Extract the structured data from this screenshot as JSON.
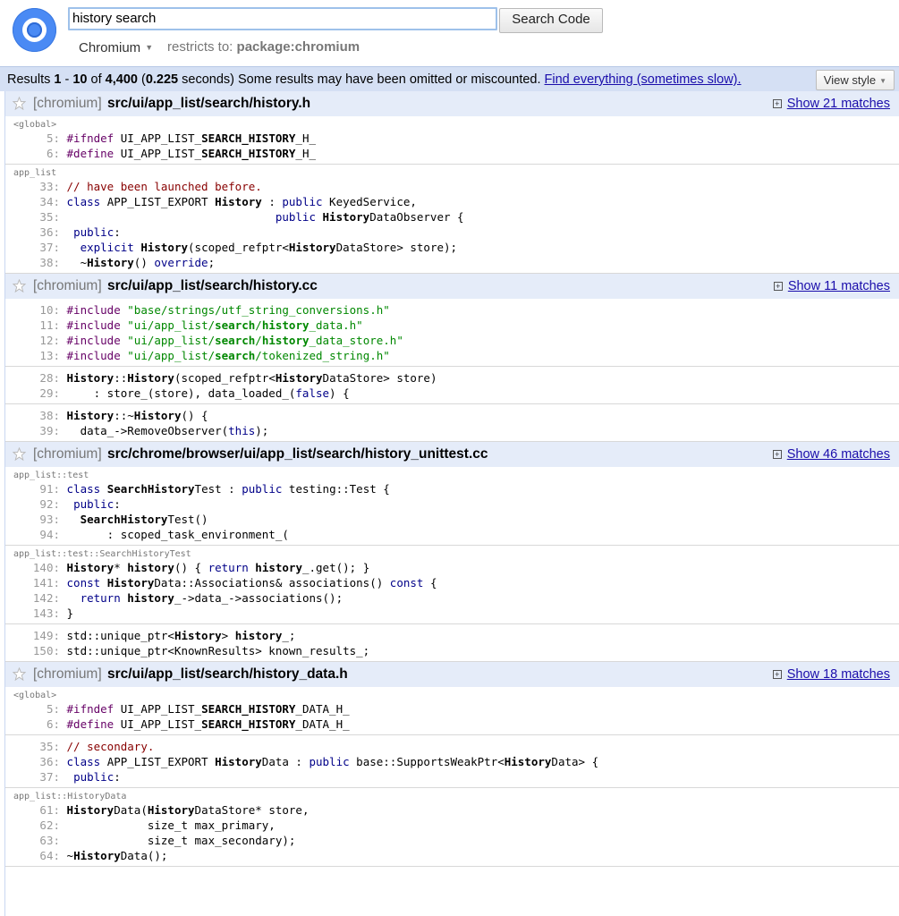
{
  "header": {
    "search_value": "history search",
    "search_button": "Search Code",
    "project": "Chromium",
    "restrict_label": "restricts to:",
    "restrict_value": "package:chromium"
  },
  "results": {
    "prefix": "Results ",
    "range_start": "1",
    "dash": " - ",
    "range_end": "10",
    "of": " of ",
    "total": "4,400",
    "time_open": " (",
    "time": "0.225",
    "time_close": " seconds) Some results may have been omitted or miscounted. ",
    "find_all_link": "Find everything (sometimes slow).",
    "view_style": "View style"
  },
  "files": [
    {
      "repo": "[chromium]",
      "path": "src/ui/app_list/search/history.h",
      "show": "Show 21 matches",
      "blocks": [
        {
          "scope": "<global>",
          "lines": [
            {
              "n": "5:",
              "html": "<span class=\"pp\">#ifndef</span> UI_APP_LIST_<b class=\"hl\">SEARCH_HISTORY</b>_H_"
            },
            {
              "n": "6:",
              "html": "<span class=\"pp\">#define</span> UI_APP_LIST_<b class=\"hl\">SEARCH_HISTORY</b>_H_"
            }
          ]
        },
        {
          "scope": "app_list",
          "lines": [
            {
              "n": "33:",
              "html": "<span class=\"cm\">// have been launched before.</span>"
            },
            {
              "n": "34:",
              "html": "<span class=\"kw\">class</span> APP_LIST_EXPORT <b class=\"hl\">History</b> : <span class=\"kw\">public</span> KeyedService,"
            },
            {
              "n": "35:",
              "html": "                               <span class=\"kw\">public</span> <b class=\"hl\">History</b>DataObserver {"
            },
            {
              "n": "36:",
              "html": " <span class=\"kw\">public</span>:"
            },
            {
              "n": "37:",
              "html": "  <span class=\"kw\">explicit</span> <b class=\"hl\">History</b>(scoped_refptr&lt;<b class=\"hl\">History</b>DataStore&gt; store);"
            },
            {
              "n": "38:",
              "html": "  ~<b class=\"hl\">History</b>() <span class=\"kw\">override</span>;"
            }
          ]
        }
      ]
    },
    {
      "repo": "[chromium]",
      "path": "src/ui/app_list/search/history.cc",
      "show": "Show 11 matches",
      "blocks": [
        {
          "scope": "",
          "lines": [
            {
              "n": "10:",
              "html": "<span class=\"pp\">#include</span> <span class=\"str\">\"base/strings/utf_string_conversions.h\"</span>"
            },
            {
              "n": "11:",
              "html": "<span class=\"pp\">#include</span> <span class=\"str\">\"ui/app_list/<b class=\"hl\">search</b>/<b class=\"hl\">history</b>_data.h\"</span>"
            },
            {
              "n": "12:",
              "html": "<span class=\"pp\">#include</span> <span class=\"str\">\"ui/app_list/<b class=\"hl\">search</b>/<b class=\"hl\">history</b>_data_store.h\"</span>"
            },
            {
              "n": "13:",
              "html": "<span class=\"pp\">#include</span> <span class=\"str\">\"ui/app_list/<b class=\"hl\">search</b>/tokenized_string.h\"</span>"
            }
          ]
        },
        {
          "scope": "",
          "lines": [
            {
              "n": "28:",
              "html": "<b class=\"hl\">History</b>::<b class=\"hl\">History</b>(scoped_refptr&lt;<b class=\"hl\">History</b>DataStore&gt; store)"
            },
            {
              "n": "29:",
              "html": "    : store_(store), data_loaded_(<span class=\"kw\">false</span>) {"
            }
          ]
        },
        {
          "scope": "",
          "lines": [
            {
              "n": "38:",
              "html": "<b class=\"hl\">History</b>::~<b class=\"hl\">History</b>() {"
            },
            {
              "n": "39:",
              "html": "  data_-&gt;RemoveObserver(<span class=\"kw\">this</span>);"
            }
          ]
        }
      ]
    },
    {
      "repo": "[chromium]",
      "path": "src/chrome/browser/ui/app_list/search/history_unittest.cc",
      "show": "Show 46 matches",
      "blocks": [
        {
          "scope": "app_list::test",
          "lines": [
            {
              "n": "91:",
              "html": "<span class=\"kw\">class</span> <b class=\"hl\">SearchHistory</b>Test : <span class=\"kw\">public</span> testing::Test {"
            },
            {
              "n": "92:",
              "html": " <span class=\"kw\">public</span>:"
            },
            {
              "n": "93:",
              "html": "  <b class=\"hl\">SearchHistory</b>Test()"
            },
            {
              "n": "94:",
              "html": "      : scoped_task_environment_("
            }
          ]
        },
        {
          "scope": "app_list::test::SearchHistoryTest",
          "lines": [
            {
              "n": "140:",
              "html": "<b class=\"hl\">History</b>* <b class=\"hl\">history</b>() { <span class=\"kw\">return</span> <b class=\"hl\">history</b>_.get(); }"
            },
            {
              "n": "141:",
              "html": "<span class=\"kw\">const</span> <b class=\"hl\">History</b>Data::Associations&amp; associations() <span class=\"kw\">const</span> {"
            },
            {
              "n": "142:",
              "html": "  <span class=\"kw\">return</span> <b class=\"hl\">history</b>_-&gt;data_-&gt;associations();"
            },
            {
              "n": "143:",
              "html": "}"
            }
          ]
        },
        {
          "scope": "",
          "lines": [
            {
              "n": "149:",
              "html": "std::unique_ptr&lt;<b class=\"hl\">History</b>&gt; <b class=\"hl\">history</b>_;"
            },
            {
              "n": "150:",
              "html": "std::unique_ptr&lt;KnownResults&gt; known_results_;"
            }
          ]
        }
      ]
    },
    {
      "repo": "[chromium]",
      "path": "src/ui/app_list/search/history_data.h",
      "show": "Show 18 matches",
      "blocks": [
        {
          "scope": "<global>",
          "lines": [
            {
              "n": "5:",
              "html": "<span class=\"pp\">#ifndef</span> UI_APP_LIST_<b class=\"hl\">SEARCH_HISTORY</b>_DATA_H_"
            },
            {
              "n": "6:",
              "html": "<span class=\"pp\">#define</span> UI_APP_LIST_<b class=\"hl\">SEARCH_HISTORY</b>_DATA_H_"
            }
          ]
        },
        {
          "scope": "",
          "lines": [
            {
              "n": "35:",
              "html": "<span class=\"cm\">// secondary.</span>"
            },
            {
              "n": "36:",
              "html": "<span class=\"kw\">class</span> APP_LIST_EXPORT <b class=\"hl\">History</b>Data : <span class=\"kw\">public</span> base::SupportsWeakPtr&lt;<b class=\"hl\">History</b>Data&gt; {"
            },
            {
              "n": "37:",
              "html": " <span class=\"kw\">public</span>:"
            }
          ]
        },
        {
          "scope": "app_list::HistoryData",
          "lines": [
            {
              "n": "61:",
              "html": "<b class=\"hl\">History</b>Data(<b class=\"hl\">History</b>DataStore* store,"
            },
            {
              "n": "62:",
              "html": "            size_t max_primary,"
            },
            {
              "n": "63:",
              "html": "            size_t max_secondary);"
            },
            {
              "n": "64:",
              "html": "~<b class=\"hl\">History</b>Data();"
            }
          ]
        }
      ]
    }
  ]
}
